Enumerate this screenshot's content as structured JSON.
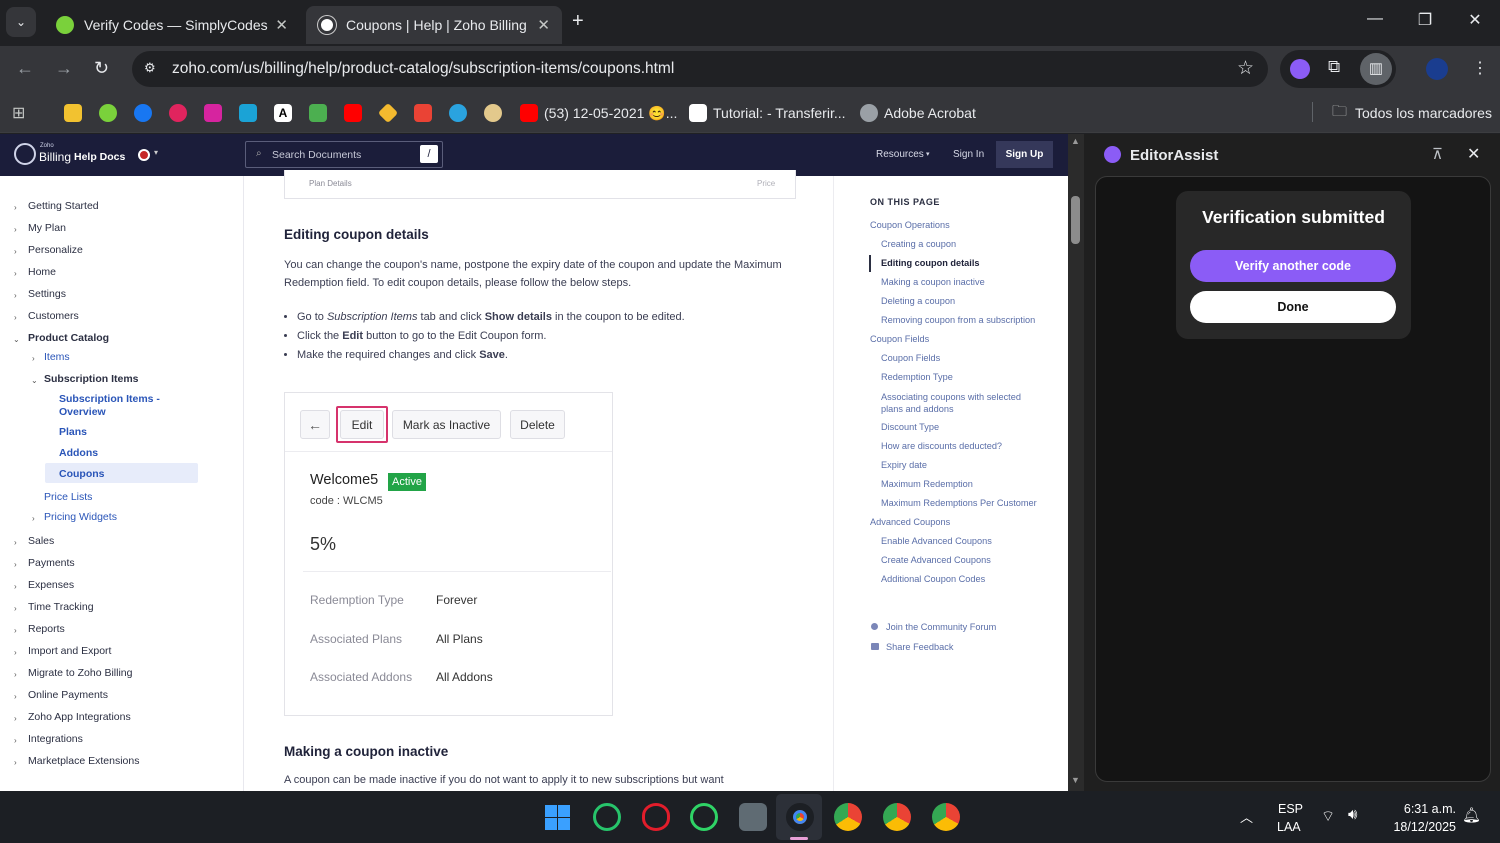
{
  "browser": {
    "tabs": [
      {
        "title": "Verify Codes — SimplyCodes",
        "active": false
      },
      {
        "title": "Coupons | Help | Zoho Billing",
        "active": true
      }
    ],
    "url": "zoho.com/us/billing/help/product-catalog/subscription-items/coupons.html",
    "bookmarks": [
      "(53) 12-05-2021 😊...",
      "Tutorial: - Transferir...",
      "Adobe Acrobat",
      "Todos los marcadores"
    ]
  },
  "zoho_header": {
    "brand_small": "Zoho",
    "brand": "Billing",
    "brand_suffix": "Help Docs",
    "search_placeholder": "Search Documents",
    "search_key": "/",
    "resources": "Resources",
    "sign_in": "Sign In",
    "sign_up": "Sign Up"
  },
  "sidebar": {
    "top_items": [
      "Getting Started",
      "My Plan",
      "Personalize",
      "Home",
      "Settings",
      "Customers"
    ],
    "product_catalog": "Product Catalog",
    "items": "Items",
    "subscription_items": "Subscription Items",
    "sub_children": [
      "Subscription Items - Overview",
      "Plans",
      "Addons",
      "Coupons"
    ],
    "price_lists": "Price Lists",
    "pricing_widgets": "Pricing Widgets",
    "bottom_items": [
      "Sales",
      "Payments",
      "Expenses",
      "Time Tracking",
      "Reports",
      "Import and Export",
      "Migrate to Zoho Billing",
      "Online Payments",
      "Zoho App Integrations",
      "Integrations",
      "Marketplace Extensions"
    ]
  },
  "content": {
    "top_caption": "Plan Details",
    "top_caption_right": "Price",
    "heading": "Editing coupon details",
    "intro": "You can change the coupon's name, postpone the expiry date of the coupon and update the Maximum Redemption field. To edit coupon details, please follow the below steps.",
    "step1_a": "Go to ",
    "step1_em": "Subscription Items",
    "step1_b": " tab and click ",
    "step1_strong": "Show details",
    "step1_c": " in the coupon to be edited.",
    "step2_a": "Click the ",
    "step2_strong": "Edit",
    "step2_b": " button to go to the Edit Coupon form.",
    "step3_a": "Make the required changes and click ",
    "step3_strong": "Save",
    "step3_b": ".",
    "figure": {
      "btn_edit": "Edit",
      "btn_inactive": "Mark as Inactive",
      "btn_delete": "Delete",
      "name": "Welcome5",
      "status": "Active",
      "code": "code : WLCM5",
      "discount": "5%",
      "rows": [
        {
          "label": "Redemption Type",
          "value": "Forever"
        },
        {
          "label": "Associated Plans",
          "value": "All Plans"
        },
        {
          "label": "Associated Addons",
          "value": "All Addons"
        }
      ]
    },
    "heading2": "Making a coupon inactive",
    "para2": "A coupon can be made inactive if you do not want to apply it to new subscriptions but want"
  },
  "toc": {
    "title": "ON THIS PAGE",
    "items": [
      {
        "label": "Coupon Operations",
        "level": 0
      },
      {
        "label": "Creating a coupon",
        "level": 1
      },
      {
        "label": "Editing coupon details",
        "level": 1,
        "active": true
      },
      {
        "label": "Making a coupon inactive",
        "level": 1
      },
      {
        "label": "Deleting a coupon",
        "level": 1
      },
      {
        "label": "Removing coupon from a subscription",
        "level": 1
      },
      {
        "label": "Coupon Fields",
        "level": 0
      },
      {
        "label": "Coupon Fields",
        "level": 1
      },
      {
        "label": "Redemption Type",
        "level": 1
      },
      {
        "label": "Associating coupons with selected plans and addons",
        "level": 1
      },
      {
        "label": "Discount Type",
        "level": 1
      },
      {
        "label": "How are discounts deducted?",
        "level": 1
      },
      {
        "label": "Expiry date",
        "level": 1
      },
      {
        "label": "Maximum Redemption",
        "level": 1
      },
      {
        "label": "Maximum Redemptions Per Customer",
        "level": 1
      },
      {
        "label": "Advanced Coupons",
        "level": 0
      },
      {
        "label": "Enable Advanced Coupons",
        "level": 1
      },
      {
        "label": "Create Advanced Coupons",
        "level": 1
      },
      {
        "label": "Additional Coupon Codes",
        "level": 1
      }
    ],
    "community": "Join the Community Forum",
    "feedback": "Share Feedback"
  },
  "editor_panel": {
    "title": "EditorAssist",
    "card_title": "Verification submitted",
    "primary_btn": "Verify another code",
    "secondary_btn": "Done",
    "accent": "#8b5cf6"
  },
  "taskbar": {
    "lang1": "ESP",
    "lang2": "LAA",
    "time": "6:31 a.m.",
    "date": "18/12/2025"
  }
}
